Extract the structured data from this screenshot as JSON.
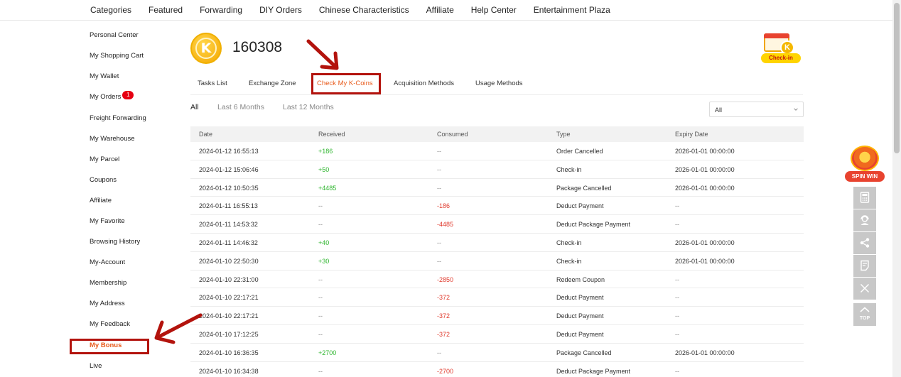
{
  "nav": {
    "items": [
      "Categories",
      "Featured",
      "Forwarding",
      "DIY Orders",
      "Chinese Characteristics",
      "Affiliate",
      "Help Center",
      "Entertainment Plaza"
    ]
  },
  "sidebar": {
    "items": [
      {
        "label": "Personal Center"
      },
      {
        "label": "My Shopping Cart"
      },
      {
        "label": "My Wallet"
      },
      {
        "label": "My Orders",
        "badge": "1"
      },
      {
        "label": "Freight Forwarding"
      },
      {
        "label": "My Warehouse"
      },
      {
        "label": "My Parcel"
      },
      {
        "label": "Coupons"
      },
      {
        "label": "Affiliate"
      },
      {
        "label": "My Favorite"
      },
      {
        "label": "Browsing History"
      },
      {
        "label": "My-Account"
      },
      {
        "label": "Membership"
      },
      {
        "label": "My Address"
      },
      {
        "label": "My Feedback"
      },
      {
        "label": "My Bonus",
        "active": true
      },
      {
        "label": "Live"
      }
    ]
  },
  "header": {
    "coin_letter": "K",
    "balance": "160308",
    "checkin_label": "Check-in",
    "checkin_coin_letter": "K"
  },
  "tabs": [
    {
      "label": "Tasks List"
    },
    {
      "label": "Exchange Zone"
    },
    {
      "label": "Check My K-Coins",
      "active": true
    },
    {
      "label": "Acquisition Methods"
    },
    {
      "label": "Usage Methods"
    }
  ],
  "filters": {
    "periods": [
      "All",
      "Last 6 Months",
      "Last 12 Months"
    ],
    "active_period": "All",
    "type_select": "All"
  },
  "table": {
    "columns": [
      "Date",
      "Received",
      "Consumed",
      "Type",
      "Expiry Date"
    ],
    "rows": [
      [
        "2024-01-12 16:55:13",
        "+186",
        "--",
        "Order Cancelled",
        "2026-01-01 00:00:00"
      ],
      [
        "2024-01-12 15:06:46",
        "+50",
        "--",
        "Check-in",
        "2026-01-01 00:00:00"
      ],
      [
        "2024-01-12 10:50:35",
        "+4485",
        "--",
        "Package Cancelled",
        "2026-01-01 00:00:00"
      ],
      [
        "2024-01-11 16:55:13",
        "--",
        "-186",
        "Deduct Payment",
        "--"
      ],
      [
        "2024-01-11 14:53:32",
        "--",
        "-4485",
        "Deduct Package Payment",
        "--"
      ],
      [
        "2024-01-11 14:46:32",
        "+40",
        "--",
        "Check-in",
        "2026-01-01 00:00:00"
      ],
      [
        "2024-01-10 22:50:30",
        "+30",
        "--",
        "Check-in",
        "2026-01-01 00:00:00"
      ],
      [
        "2024-01-10 22:31:00",
        "--",
        "-2850",
        "Redeem Coupon",
        "--"
      ],
      [
        "2024-01-10 22:17:21",
        "--",
        "-372",
        "Deduct Payment",
        "--"
      ],
      [
        "2024-01-10 22:17:21",
        "--",
        "-372",
        "Deduct Payment",
        "--"
      ],
      [
        "2024-01-10 17:12:25",
        "--",
        "-372",
        "Deduct Payment",
        "--"
      ],
      [
        "2024-01-10 16:36:35",
        "+2700",
        "--",
        "Package Cancelled",
        "2026-01-01 00:00:00"
      ],
      [
        "2024-01-10 16:34:38",
        "--",
        "-2700",
        "Deduct Package Payment",
        "--"
      ]
    ]
  },
  "floating": {
    "spin_label": "SPIN WIN",
    "top_label": "TOP",
    "tools": [
      "calculator-icon",
      "customer-service-icon",
      "share-icon",
      "feedback-icon",
      "close-icon"
    ]
  },
  "colors": {
    "accent": "#e85b1c",
    "annotation": "#b3130d",
    "positive": "#2db52d",
    "negative": "#e03b2e"
  }
}
